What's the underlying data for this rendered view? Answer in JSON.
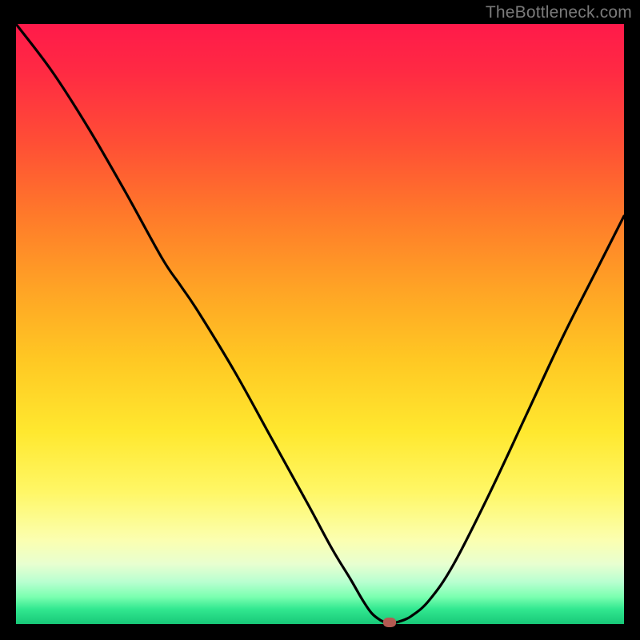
{
  "attribution": "TheBottleneck.com",
  "chart_data": {
    "type": "line",
    "title": "",
    "xlabel": "",
    "ylabel": "",
    "xlim": [
      0,
      100
    ],
    "ylim": [
      0,
      100
    ],
    "grid": false,
    "legend": false,
    "series": [
      {
        "name": "bottleneck-curve",
        "x": [
          0,
          6,
          12,
          18,
          24,
          27,
          30,
          36,
          42,
          48,
          52,
          55,
          57,
          58.5,
          60,
          61,
          62,
          63,
          65,
          68,
          72,
          78,
          84,
          90,
          96,
          100
        ],
        "y": [
          100,
          92,
          82.5,
          72,
          61,
          56.5,
          52,
          42,
          31,
          20,
          12.5,
          7.5,
          4,
          1.8,
          0.6,
          0.2,
          0.2,
          0.4,
          1.3,
          4,
          10,
          22,
          35,
          48,
          60,
          68
        ]
      }
    ],
    "minimum_marker": {
      "x": 61.5,
      "y": 0.3
    },
    "gradient_stops": [
      {
        "pct": 0,
        "color": "#ff1a4a"
      },
      {
        "pct": 8,
        "color": "#ff2a43"
      },
      {
        "pct": 20,
        "color": "#ff4f35"
      },
      {
        "pct": 32,
        "color": "#ff7a2a"
      },
      {
        "pct": 44,
        "color": "#ffa325"
      },
      {
        "pct": 56,
        "color": "#ffc823"
      },
      {
        "pct": 68,
        "color": "#ffe82f"
      },
      {
        "pct": 78,
        "color": "#fff766"
      },
      {
        "pct": 86,
        "color": "#fbffb0"
      },
      {
        "pct": 90,
        "color": "#e8ffd0"
      },
      {
        "pct": 93,
        "color": "#b8ffd0"
      },
      {
        "pct": 95.5,
        "color": "#7affb0"
      },
      {
        "pct": 97.5,
        "color": "#32e890"
      },
      {
        "pct": 100,
        "color": "#18c878"
      }
    ]
  }
}
